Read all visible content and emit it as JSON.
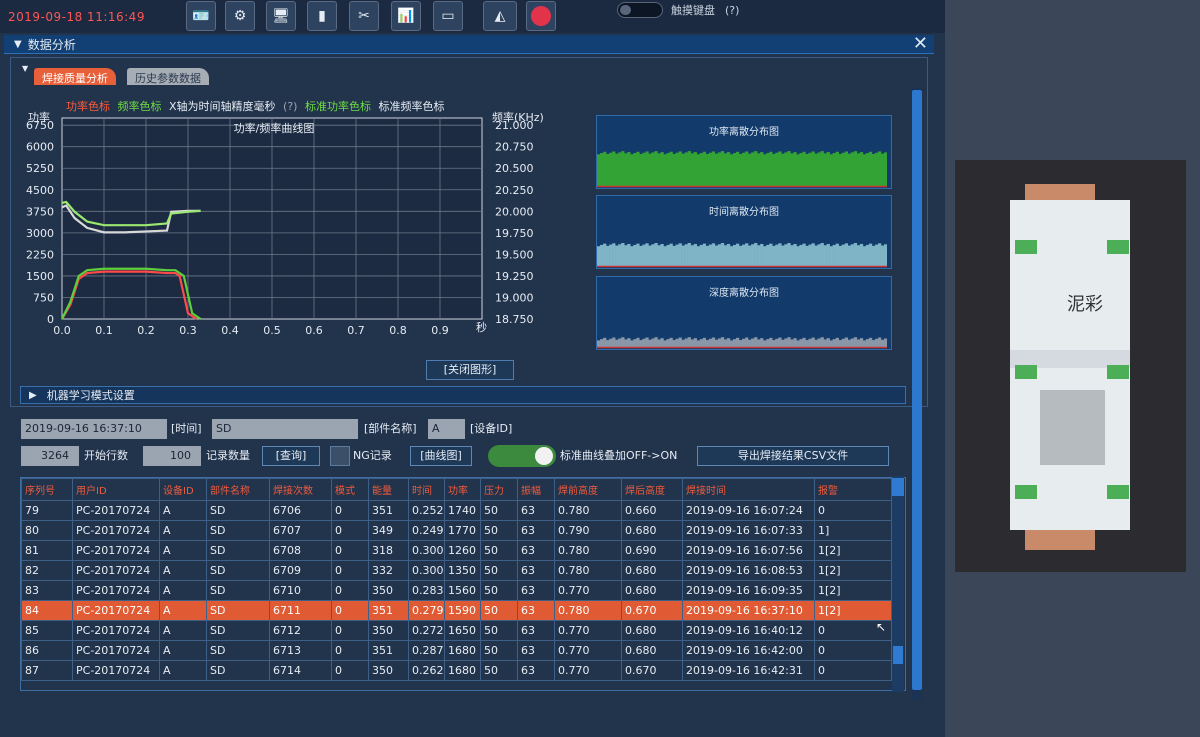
{
  "topbar": {
    "datetime": "2019-09-18 11:16:49",
    "toolbar_icons": [
      "id-card-icon",
      "gauge-icon",
      "screen-icon",
      "bottle-icon",
      "tools-icon",
      "bar-chart-icon",
      "card-icon",
      "brand-icon",
      "stop-icon"
    ],
    "keyboard_label": "触摸键盘",
    "keyboard_help": "(?)"
  },
  "panel": {
    "title": "数据分析"
  },
  "tabs": [
    "焊接质量分析",
    "历史参数数据"
  ],
  "legend": {
    "power_color": "功率色标",
    "freq_color": "频率色标",
    "xaxis_note": "X轴为时间轴精度毫秒",
    "help": "(?)",
    "std_power_color": "标准功率色标",
    "std_freq_color": "标准频率色标"
  },
  "chart_data": {
    "type": "line",
    "title": "功率/频率曲线图",
    "ylabel": "功率",
    "y2label": "频率(KHz)",
    "xlabel": "秒",
    "xlim": [
      0,
      1.0
    ],
    "ylim": [
      0,
      7000
    ],
    "y2lim": [
      18.75,
      21.0
    ],
    "yticks": [
      "0",
      "750",
      "1500",
      "2250",
      "3000",
      "3750",
      "4500",
      "5250",
      "6000",
      "6750"
    ],
    "y2ticks": [
      "18.750",
      "19.000",
      "19.250",
      "19.500",
      "19.750",
      "20.000",
      "20.250",
      "20.500",
      "20.750",
      "21.000"
    ],
    "xticks": [
      "0.0",
      "0.1",
      "0.2",
      "0.3",
      "0.4",
      "0.5",
      "0.6",
      "0.7",
      "0.8",
      "0.9"
    ],
    "grid": true,
    "series": [
      {
        "name": "功率",
        "color": "#ff4a4a",
        "x": [
          0,
          0.02,
          0.04,
          0.06,
          0.1,
          0.15,
          0.2,
          0.25,
          0.27,
          0.28,
          0.3,
          0.32
        ],
        "y": [
          0,
          500,
          1400,
          1600,
          1650,
          1650,
          1650,
          1600,
          1600,
          1500,
          200,
          0
        ]
      },
      {
        "name": "标准功率",
        "color": "#5ecf3a",
        "x": [
          0,
          0.02,
          0.04,
          0.06,
          0.1,
          0.15,
          0.2,
          0.25,
          0.27,
          0.29,
          0.31,
          0.33
        ],
        "y": [
          0,
          600,
          1500,
          1700,
          1750,
          1750,
          1750,
          1700,
          1700,
          1500,
          200,
          0
        ]
      },
      {
        "name": "频率",
        "color": "#d8d8d8",
        "x": [
          0,
          0.01,
          0.03,
          0.06,
          0.1,
          0.15,
          0.2,
          0.25,
          0.26,
          0.3,
          0.33
        ],
        "y": [
          20.0,
          20.02,
          19.88,
          19.77,
          19.72,
          19.72,
          19.73,
          19.74,
          19.95,
          19.96,
          19.96
        ]
      },
      {
        "name": "标准频率",
        "color": "#9be870",
        "x": [
          0,
          0.01,
          0.03,
          0.06,
          0.1,
          0.15,
          0.2,
          0.25,
          0.26,
          0.3,
          0.33
        ],
        "y": [
          20.05,
          20.06,
          19.95,
          19.84,
          19.8,
          19.8,
          19.8,
          19.82,
          19.93,
          19.95,
          19.96
        ]
      }
    ]
  },
  "distributions": [
    {
      "title": "功率离散分布图",
      "level": 0.72,
      "bar_color": "#33a335",
      "line_color": "#cc3333"
    },
    {
      "title": "时间离散分布图",
      "level": 0.45,
      "bar_color": "#7fb3c6",
      "line_color": "#cc3333"
    },
    {
      "title": "深度离散分布图",
      "level": 0.15,
      "bar_color": "#8a97a8",
      "line_color": "#cc3333"
    }
  ],
  "close_chart_button": "[关闭图形]",
  "ml_section": "机器学习模式设置",
  "filters": {
    "datetime_value": "2019-09-16 16:37:10",
    "time_label": "[时间]",
    "part_value": "SD",
    "part_label": "[部件名称]",
    "device_value": "A",
    "device_label": "[设备ID]",
    "start_row_value": "3264",
    "start_row_label": "开始行数",
    "count_value": "100",
    "count_label": "记录数量",
    "query_button": "[查询]",
    "ng_label": "NG记录",
    "curve_button": "[曲线图]",
    "overlay_label": "标准曲线叠加OFF->ON",
    "export_button": "导出焊接结果CSV文件"
  },
  "table": {
    "headers": [
      "序列号",
      "用户ID",
      "设备ID",
      "部件名称",
      "焊接次数",
      "模式",
      "能量",
      "时间",
      "功率",
      "压力",
      "振幅",
      "焊前高度",
      "焊后高度",
      "焊接时间",
      "报警"
    ],
    "rows": [
      [
        "79",
        "PC-20170724",
        "A",
        "SD",
        "6706",
        "0",
        "351",
        "0.252",
        "1740",
        "50",
        "63",
        "0.780",
        "0.660",
        "2019-09-16 16:07:24",
        "0"
      ],
      [
        "80",
        "PC-20170724",
        "A",
        "SD",
        "6707",
        "0",
        "349",
        "0.249",
        "1770",
        "50",
        "63",
        "0.790",
        "0.680",
        "2019-09-16 16:07:33",
        "1]"
      ],
      [
        "81",
        "PC-20170724",
        "A",
        "SD",
        "6708",
        "0",
        "318",
        "0.300",
        "1260",
        "50",
        "63",
        "0.780",
        "0.690",
        "2019-09-16 16:07:56",
        "1[2]"
      ],
      [
        "82",
        "PC-20170724",
        "A",
        "SD",
        "6709",
        "0",
        "332",
        "0.300",
        "1350",
        "50",
        "63",
        "0.780",
        "0.680",
        "2019-09-16 16:08:53",
        "1[2]"
      ],
      [
        "83",
        "PC-20170724",
        "A",
        "SD",
        "6710",
        "0",
        "350",
        "0.283",
        "1560",
        "50",
        "63",
        "0.770",
        "0.680",
        "2019-09-16 16:09:35",
        "1[2]"
      ],
      [
        "84",
        "PC-20170724",
        "A",
        "SD",
        "6711",
        "0",
        "351",
        "0.279",
        "1590",
        "50",
        "63",
        "0.780",
        "0.670",
        "2019-09-16 16:37:10",
        "1[2]"
      ],
      [
        "85",
        "PC-20170724",
        "A",
        "SD",
        "6712",
        "0",
        "350",
        "0.272",
        "1650",
        "50",
        "63",
        "0.770",
        "0.680",
        "2019-09-16 16:40:12",
        "0"
      ],
      [
        "86",
        "PC-20170724",
        "A",
        "SD",
        "6713",
        "0",
        "351",
        "0.287",
        "1680",
        "50",
        "63",
        "0.770",
        "0.680",
        "2019-09-16 16:42:00",
        "0"
      ],
      [
        "87",
        "PC-20170724",
        "A",
        "SD",
        "6714",
        "0",
        "350",
        "0.262",
        "1680",
        "50",
        "63",
        "0.770",
        "0.670",
        "2019-09-16 16:42:31",
        "0"
      ]
    ],
    "selected_row": 5
  },
  "photo": {
    "handwriting": "泥彩"
  }
}
